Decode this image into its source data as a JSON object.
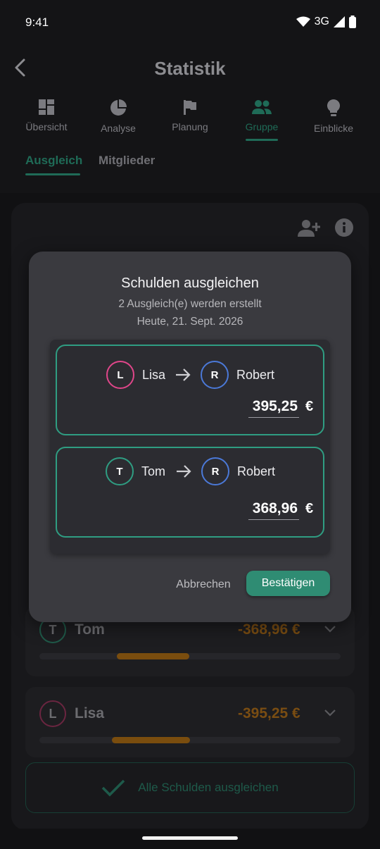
{
  "status_bar": {
    "time": "9:41",
    "network": "3G"
  },
  "header": {
    "title": "Statistik"
  },
  "tabs": [
    {
      "label": "Übersicht",
      "icon": "dashboard-icon"
    },
    {
      "label": "Analyse",
      "icon": "pie-chart-icon"
    },
    {
      "label": "Planung",
      "icon": "flag-icon"
    },
    {
      "label": "Gruppe",
      "icon": "group-icon",
      "active": true
    },
    {
      "label": "Einblicke",
      "icon": "lightbulb-icon"
    }
  ],
  "subtabs": [
    {
      "label": "Ausgleich",
      "active": true
    },
    {
      "label": "Mitglieder"
    }
  ],
  "members": [
    {
      "initial": "T",
      "name": "Tom",
      "amount": "-368,96 €",
      "bar_fraction": 0.24,
      "color": "#1f5a49"
    },
    {
      "initial": "L",
      "name": "Lisa",
      "amount": "-395,25 €",
      "bar_fraction": 0.26,
      "color": "#6a2540"
    }
  ],
  "settle_all_label": "Alle Schulden ausgleichen",
  "dialog": {
    "title": "Schulden ausgleichen",
    "subtitle": "2 Ausgleich(e) werden erstellt",
    "date": "Heute, 21. Sept. 2026",
    "transfers": [
      {
        "from_initial": "L",
        "from_name": "Lisa",
        "from_color": "#e0468a",
        "to_initial": "R",
        "to_name": "Robert",
        "to_color": "#4b79d8",
        "amount": "395,25",
        "currency": "€"
      },
      {
        "from_initial": "T",
        "from_name": "Tom",
        "from_color": "#2f9d82",
        "to_initial": "R",
        "to_name": "Robert",
        "to_color": "#4b79d8",
        "amount": "368,96",
        "currency": "€"
      }
    ],
    "cancel_label": "Abbrechen",
    "confirm_label": "Bestätigen"
  },
  "colors": {
    "accent": "#2f8c73",
    "negative": "#e08a1e"
  }
}
